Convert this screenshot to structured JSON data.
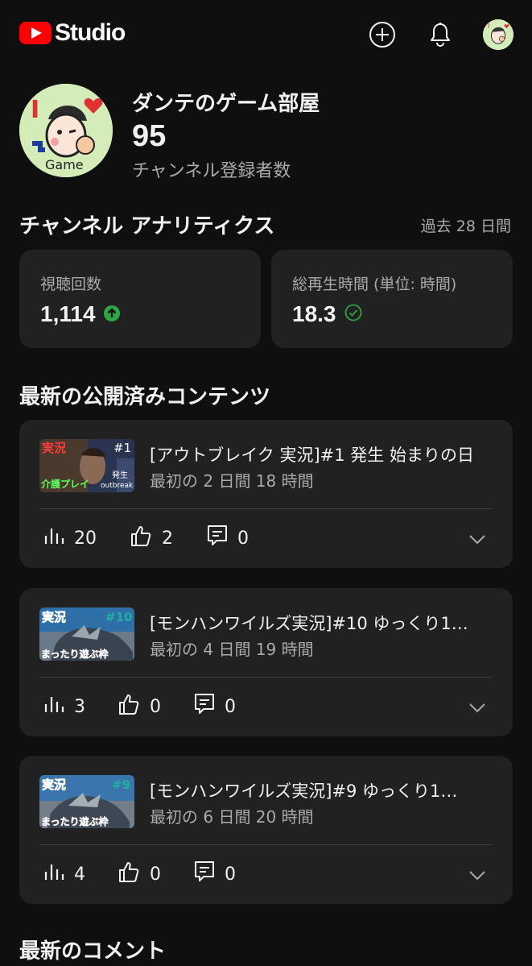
{
  "app": {
    "logo_text": "Studio",
    "brand_color": "#ff0000"
  },
  "header_icons": [
    "add-circle-icon",
    "bell-icon",
    "account-avatar"
  ],
  "channel": {
    "name": "ダンテのゲーム部屋",
    "subscribers": "95",
    "subscribers_label": "チャンネル登録者数"
  },
  "analytics": {
    "title": "チャンネル アナリティクス",
    "period": "過去 28 日間",
    "metrics": [
      {
        "label": "視聴回数",
        "value": "1,114",
        "status_icon": "arrow-up-circle-icon",
        "status_color": "#2ba640"
      },
      {
        "label": "総再生時間 (単位: 時間)",
        "value": "18.3",
        "status_icon": "check-circle-icon",
        "status_color": "#2ba640"
      }
    ]
  },
  "latest_content": {
    "title": "最新の公開済みコンテンツ",
    "videos": [
      {
        "title": "[アウトブレイク 実況]#1 発生 始まりの日",
        "subtitle": "最初の 2 日間 18 時間",
        "views": "20",
        "likes": "2",
        "comments": "0",
        "thumb": {
          "tag": "実況",
          "episode": "#1",
          "left_caption": "介護プレイ",
          "right_caption_top": "発生",
          "right_caption_bottom": "outbreak"
        }
      },
      {
        "title": "[モンハンワイルズ実況]#10 ゆっくり1…",
        "subtitle": "最初の 4 日間 19 時間",
        "views": "3",
        "likes": "0",
        "comments": "0",
        "thumb": {
          "tag": "実況",
          "episode": "#10",
          "left_caption": "まったり遊ぶ枠"
        }
      },
      {
        "title": "[モンハンワイルズ実況]#9 ゆっくり1…",
        "subtitle": "最初の 6 日間 20 時間",
        "views": "4",
        "likes": "0",
        "comments": "0",
        "thumb": {
          "tag": "実況",
          "episode": "#9",
          "left_caption": "まったり遊ぶ枠"
        }
      }
    ]
  },
  "latest_comments": {
    "title": "最新のコメント"
  },
  "avatar_text": {
    "top": "I",
    "bottom": "Game"
  }
}
